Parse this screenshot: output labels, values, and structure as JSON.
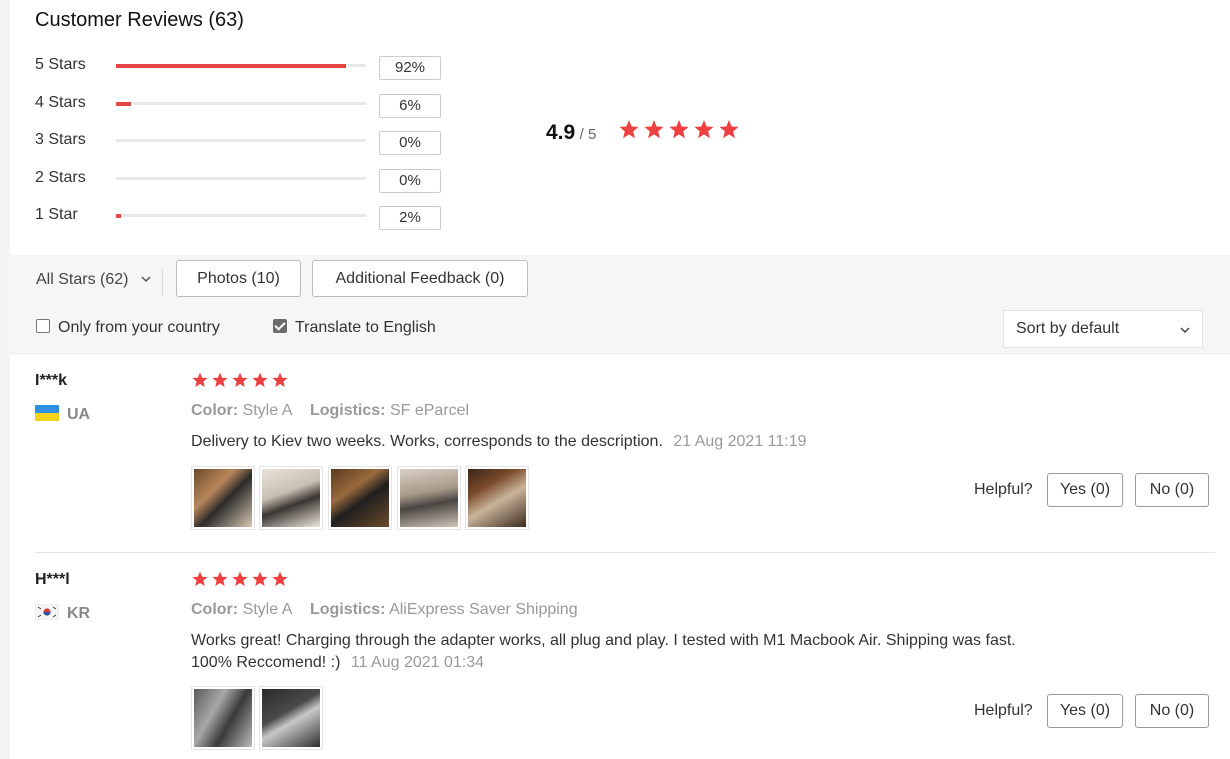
{
  "header": {
    "title": "Customer Reviews (63)"
  },
  "distribution": [
    {
      "label": "5 Stars",
      "percent_text": "92%",
      "percent": 92
    },
    {
      "label": "4 Stars",
      "percent_text": "6%",
      "percent": 6
    },
    {
      "label": "3 Stars",
      "percent_text": "0%",
      "percent": 0
    },
    {
      "label": "2 Stars",
      "percent_text": "0%",
      "percent": 0
    },
    {
      "label": "1 Star",
      "percent_text": "2%",
      "percent": 2
    }
  ],
  "score": {
    "value": "4.9",
    "out_of": "/ 5",
    "stars": 5
  },
  "filters": {
    "all_stars": "All Stars (62)",
    "photos": "Photos (10)",
    "additional": "Additional Feedback (0)",
    "only_country": "Only from your country",
    "translate": "Translate to English",
    "translate_checked": true,
    "only_country_checked": false,
    "sort": "Sort by default"
  },
  "colors": {
    "accent": "#e64545",
    "star": "#ee4040"
  },
  "reviews": [
    {
      "user": "I***k",
      "country": "UA",
      "flag_icon": "ukraine-flag-icon",
      "stars": 5,
      "color_label": "Color:",
      "color_value": "Style A",
      "logistics_label": "Logistics:",
      "logistics_value": "SF eParcel",
      "text": "Delivery to Kiev two weeks. Works, corresponds to the description.",
      "date": "21 Aug 2021 11:19",
      "helpful": "Helpful?",
      "yes": "Yes (0)",
      "no": "No (0)",
      "photo_count": 5
    },
    {
      "user": "H***l",
      "country": "KR",
      "flag_icon": "south-korea-flag-icon",
      "stars": 5,
      "color_label": "Color:",
      "color_value": "Style A",
      "logistics_label": "Logistics:",
      "logistics_value": "AliExpress Saver Shipping",
      "text_line1": "Works great! Charging through the adapter works, all plug and play. I tested with M1 Macbook Air. Shipping was fast.",
      "text_line2": "100% Reccomend! :)",
      "date": "11 Aug 2021 01:34",
      "helpful": "Helpful?",
      "yes": "Yes (0)",
      "no": "No (0)",
      "photo_count": 2
    }
  ]
}
